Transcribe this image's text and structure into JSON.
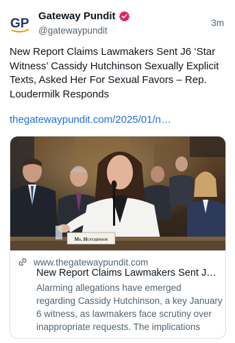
{
  "post": {
    "author_name": "Gateway Pundit",
    "author_handle": "@gatewaypundit",
    "time_ago": "3m",
    "avatar_text": "GP",
    "text": "New Report Claims Lawmakers Sent J6 ‘Star Witness’ Cassidy Hutchinson Sexually Explicit Texts, Asked Her For Sexual Favors – Rep. Loudermilk Responds",
    "link_text": "thegatewaypundit.com/2025/01/n…"
  },
  "card": {
    "domain": "www.thegatewaypundit.com",
    "title": "New Report Claims Lawmakers Sent J…",
    "description": "Alarming allegations have emerged regarding Cassidy Hutchinson, a key January 6 witness, as lawmakers face scrutiny over inappropriate requests. The implications for…",
    "nameplate_text": "Ms. Hutchinson"
  },
  "icons": {
    "verified": "verified-badge-icon",
    "link": "link-icon"
  },
  "colors": {
    "link": "#1d6fe0",
    "secondary_text": "#536471",
    "verified_badge": "#e0245e",
    "avatar_blue": "#1d3a6e",
    "avatar_accent": "#e8a21c"
  }
}
